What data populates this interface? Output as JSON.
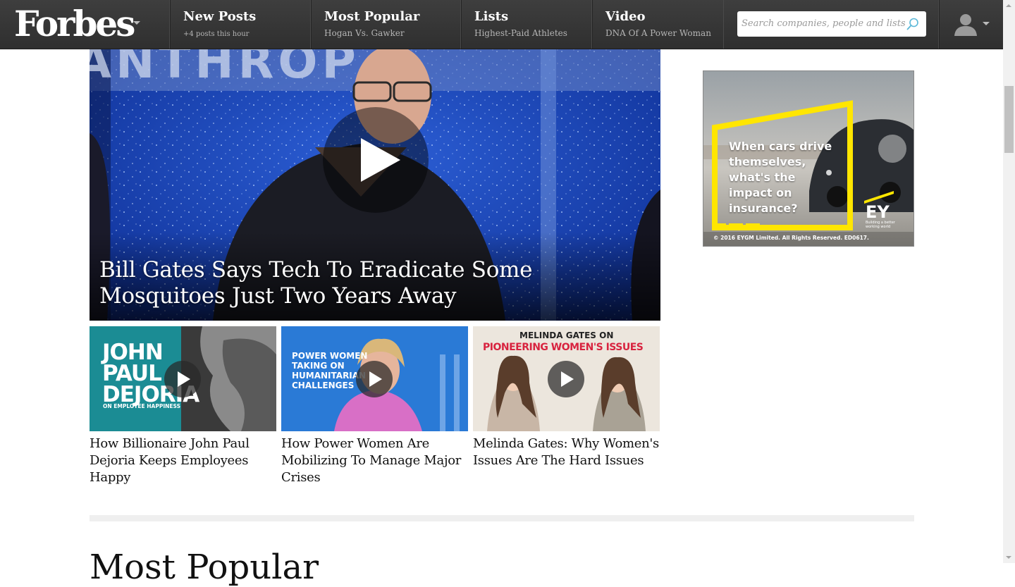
{
  "brand": {
    "logo": "Forbes"
  },
  "nav": [
    {
      "title": "New Posts",
      "subtitle": "+4 posts this hour"
    },
    {
      "title": "Most Popular",
      "subtitle": "Hogan Vs. Gawker"
    },
    {
      "title": "Lists",
      "subtitle": "Highest-Paid Athletes"
    },
    {
      "title": "Video",
      "subtitle": "DNA Of A Power Woman"
    }
  ],
  "search": {
    "placeholder": "Search companies, people and lists",
    "value": ""
  },
  "hero": {
    "headline": "Bill Gates Says Tech To Eradicate Some Mosquitoes Just Two Years Away",
    "backdrop_text": "ANTHROP"
  },
  "videos": [
    {
      "caption": "How Billionaire John Paul Dejoria Keeps Employees Happy",
      "overlay_name": "JOHN\nPAUL\nDEJORIA",
      "overlay_sub": "ON EMPLOYEE HAPPINESS"
    },
    {
      "caption": "How Power Women Are Mobilizing To Manage Major Crises",
      "overlay_name": "POWER WOMEN\nTAKING ON\nHUMANITARIAN\nCHALLENGES"
    },
    {
      "caption": "Melinda Gates: Why Women's Issues Are The Hard Issues",
      "overlay_top": "MELINDA GATES ON",
      "overlay_name": "PIONEERING WOMEN'S ISSUES"
    }
  ],
  "ad": {
    "headline": "When cars drive themselves, what's the impact on insurance?",
    "brand": "EY",
    "tagline": "Building a better working world",
    "copyright": "© 2016 EYGM Limited. All Rights Reserved. ED0617."
  },
  "next_section": {
    "heading": "Most Popular"
  },
  "colors": {
    "topbar": "#363636",
    "ey_yellow": "#ffe600",
    "link_text": "#111111"
  }
}
